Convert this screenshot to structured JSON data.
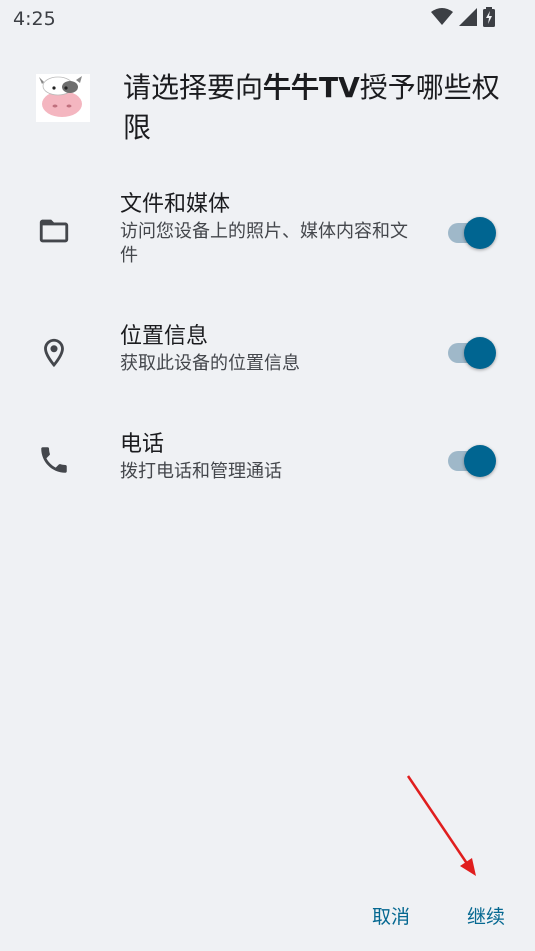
{
  "status_bar": {
    "time": "4:25",
    "icons": [
      "wifi-icon",
      "signal-icon",
      "battery-charging-icon"
    ]
  },
  "header": {
    "app_icon": "cow-app-icon",
    "title_prefix": "请选择要向",
    "app_name": "牛牛TV",
    "title_suffix": "授予哪些权限"
  },
  "permissions": [
    {
      "icon": "folder-icon",
      "title": "文件和媒体",
      "description": "访问您设备上的照片、媒体内容和文件",
      "enabled": true
    },
    {
      "icon": "location-pin-icon",
      "title": "位置信息",
      "description": "获取此设备的位置信息",
      "enabled": true
    },
    {
      "icon": "phone-icon",
      "title": "电话",
      "description": "拨打电话和管理通话",
      "enabled": true
    }
  ],
  "footer": {
    "cancel_label": "取消",
    "continue_label": "继续"
  },
  "colors": {
    "accent": "#006591",
    "background": "#eff1f4",
    "annotation_arrow": "#e01e1e"
  }
}
